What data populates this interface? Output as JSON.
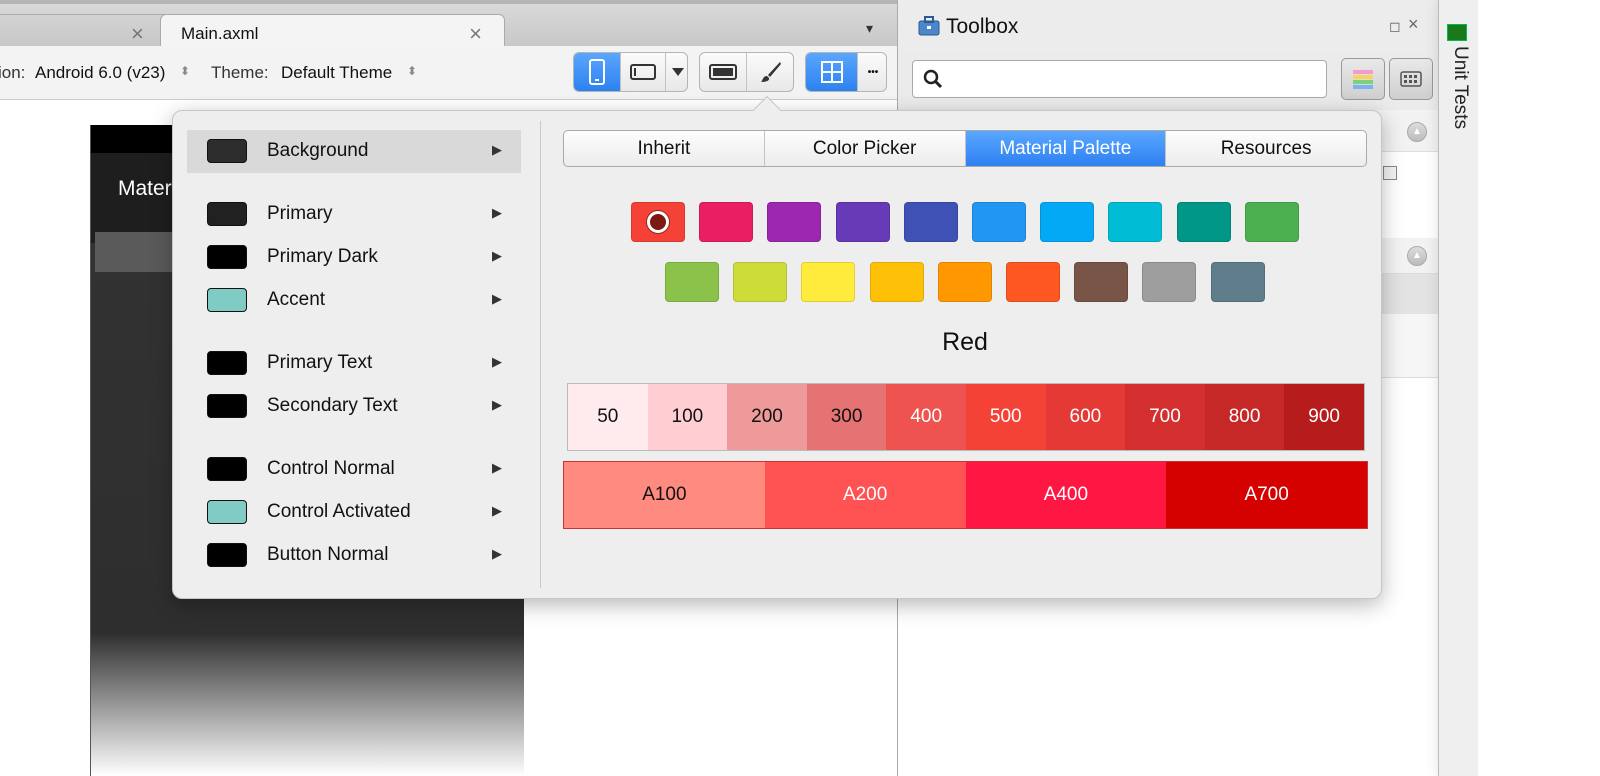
{
  "tabs": {
    "previous_close": "×",
    "main_title": "Main.axml",
    "main_close": "×",
    "overflow": "▾"
  },
  "toolbar": {
    "api_label": "ion:",
    "api_value": "Android 6.0 (v23)",
    "theme_label": "Theme:",
    "theme_value": "Default Theme",
    "updown": "⬍",
    "more": "•••"
  },
  "phone": {
    "title": "Mater"
  },
  "toolbox": {
    "title": "Toolbox",
    "restore": "◻",
    "close": "×",
    "search_placeholder": ""
  },
  "side": {
    "unit_tests": "Unit Tests"
  },
  "popover": {
    "properties": [
      {
        "label": "Background",
        "color": "#2d2d2d",
        "selected": true
      },
      {
        "label": "Primary",
        "color": "#212121"
      },
      {
        "label": "Primary Dark",
        "color": "#000000"
      },
      {
        "label": "Accent",
        "color": "#80cbc4"
      },
      {
        "label": "Primary Text",
        "color": "#000000"
      },
      {
        "label": "Secondary Text",
        "color": "#000000"
      },
      {
        "label": "Control Normal",
        "color": "#000000"
      },
      {
        "label": "Control Activated",
        "color": "#80cbc4"
      },
      {
        "label": "Button Normal",
        "color": "#000000"
      }
    ],
    "arrow": "▶",
    "tabs": [
      "Inherit",
      "Color Picker",
      "Material Palette",
      "Resources"
    ],
    "active_tab": "Material Palette",
    "palette_row1": [
      "#f44336",
      "#e91e63",
      "#9c27b0",
      "#673ab7",
      "#3f51b5",
      "#2196f3",
      "#03a9f4",
      "#00bcd4",
      "#009688",
      "#4caf50"
    ],
    "palette_row2": [
      "#8bc34a",
      "#cddc39",
      "#ffeb3b",
      "#ffc107",
      "#ff9800",
      "#ff5722",
      "#795548",
      "#9e9e9e",
      "#607d8b"
    ],
    "selected_color": "Red",
    "shades": [
      {
        "label": "50",
        "color": "#ffebee",
        "text": "#111"
      },
      {
        "label": "100",
        "color": "#ffcdd2",
        "text": "#111"
      },
      {
        "label": "200",
        "color": "#ef9a9a",
        "text": "#111"
      },
      {
        "label": "300",
        "color": "#e57373",
        "text": "#111"
      },
      {
        "label": "400",
        "color": "#ef5350",
        "text": "#fff"
      },
      {
        "label": "500",
        "color": "#f44336",
        "text": "#fff"
      },
      {
        "label": "600",
        "color": "#e53935",
        "text": "#fff"
      },
      {
        "label": "700",
        "color": "#d32f2f",
        "text": "#fff"
      },
      {
        "label": "800",
        "color": "#c62828",
        "text": "#fff"
      },
      {
        "label": "900",
        "color": "#b71c1c",
        "text": "#fff"
      }
    ],
    "accents": [
      {
        "label": "A100",
        "color": "#ff8a80",
        "text": "#111"
      },
      {
        "label": "A200",
        "color": "#ff5252",
        "text": "#fff"
      },
      {
        "label": "A400",
        "color": "#ff1744",
        "text": "#fff"
      },
      {
        "label": "A700",
        "color": "#d50000",
        "text": "#fff"
      }
    ]
  }
}
